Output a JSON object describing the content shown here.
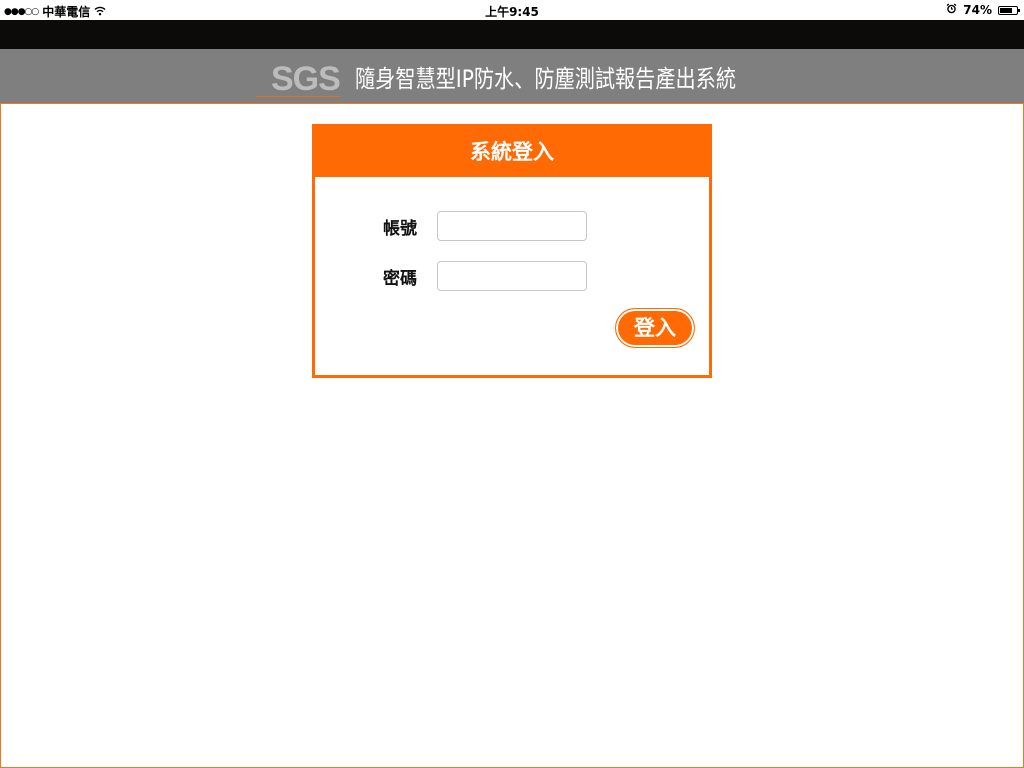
{
  "status_bar": {
    "signal": "●●●○○",
    "carrier": "中華電信",
    "wifi_icon": "wifi-icon",
    "time": "上午9:45",
    "alarm_icon": "alarm-clock-icon",
    "battery_text": "74%",
    "battery_level": 0.74
  },
  "header": {
    "logo": "SGS",
    "title": "隨身智慧型IP防水、防塵測試報告產出系統"
  },
  "login": {
    "title": "系統登入",
    "account_label": "帳號",
    "account_value": "",
    "password_label": "密碼",
    "password_value": "",
    "submit_label": "登入"
  },
  "colors": {
    "accent": "#ff6a05",
    "header_bg": "#7f7f7f",
    "top_band": "#0d0b0a"
  }
}
